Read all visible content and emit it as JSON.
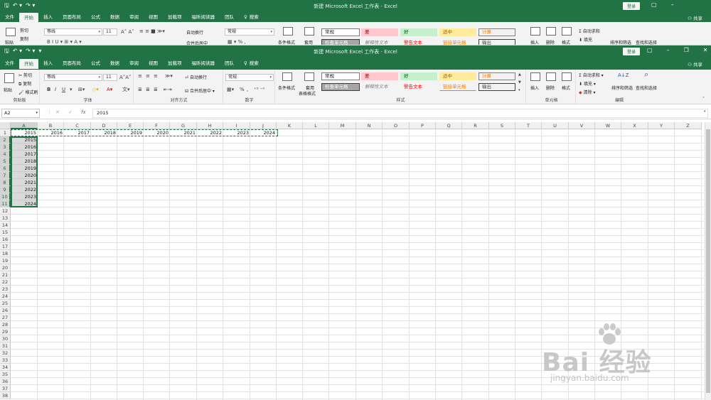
{
  "back_window": {
    "title": "新建 Microsoft Excel 工作表  -  Excel",
    "signin": "登录",
    "share": "共享",
    "tabs": [
      "文件",
      "开始",
      "插入",
      "页面布局",
      "公式",
      "数据",
      "审阅",
      "视图",
      "加载项",
      "福昕阅读器",
      "团队"
    ],
    "tellme": "搜索",
    "font_name": "等线",
    "font_size": "11",
    "number_format": "常规",
    "styles": [
      "常规",
      "差",
      "好",
      "适中",
      "计算",
      "检查单元格",
      "解释性文本",
      "警告文本",
      "链接单元格",
      "输出"
    ]
  },
  "window": {
    "title": "新建 Microsoft Excel 工作表  -  Excel",
    "signin": "登录",
    "share": "共享",
    "tabs": [
      "文件",
      "开始",
      "插入",
      "页面布局",
      "公式",
      "数据",
      "审阅",
      "视图",
      "加载项",
      "福昕阅读器",
      "团队"
    ],
    "active_tab": "开始",
    "tellme": "搜索"
  },
  "ribbon": {
    "clipboard": {
      "paste": "粘贴",
      "cut": "剪切",
      "copy": "复制",
      "format_painter": "格式刷",
      "label": "剪贴板"
    },
    "font": {
      "name": "等线",
      "size": "11",
      "bold": "B",
      "italic": "I",
      "underline": "U",
      "label": "字体"
    },
    "alignment": {
      "wrap": "自动换行",
      "merge": "合并后居中",
      "label": "对齐方式"
    },
    "number": {
      "format": "常规",
      "percent": "%",
      "comma": ",",
      "label": "数字"
    },
    "styles": {
      "conditional": "条件格式",
      "table": "套用\n表格格式",
      "table_line1": "套用",
      "table_line2": "表格格式",
      "items": [
        {
          "text": "常规",
          "bg": "#ffffff",
          "color": "#111111",
          "border": "#7a7a7a"
        },
        {
          "text": "差",
          "bg": "#ffc7ce",
          "color": "#9c0006",
          "border": "#ffc7ce"
        },
        {
          "text": "好",
          "bg": "#c6efce",
          "color": "#006100",
          "border": "#c6efce"
        },
        {
          "text": "适中",
          "bg": "#ffeb9c",
          "color": "#9c5700",
          "border": "#ffeb9c"
        },
        {
          "text": "计算",
          "bg": "#f2f2f2",
          "color": "#fa7d00",
          "border": "#7f7f7f"
        },
        {
          "text": "检查单元格",
          "bg": "#a5a5a5",
          "color": "#ffffff",
          "border": "#3f3f3f"
        },
        {
          "text": "解释性文本",
          "bg": "#f3f3f3",
          "color": "#7f7f7f",
          "border": "#f3f3f3"
        },
        {
          "text": "警告文本",
          "bg": "#f3f3f3",
          "color": "#ff0000",
          "border": "#f3f3f3"
        },
        {
          "text": "链接单元格",
          "bg": "#f3f3f3",
          "color": "#fa7d00",
          "border": "#f3f3f3"
        },
        {
          "text": "输出",
          "bg": "#f2f2f2",
          "color": "#3f3f3f",
          "border": "#3f3f3f"
        }
      ],
      "label": "样式"
    },
    "cells": {
      "insert": "插入",
      "delete": "删除",
      "format": "格式",
      "label": "单元格"
    },
    "editing": {
      "autosum": "自动求和",
      "fill": "填充",
      "clear": "清除",
      "sort": "排序和筛选",
      "find": "查找和选择",
      "label": "编辑"
    }
  },
  "formula_bar": {
    "name_box": "A2",
    "cancel": "✕",
    "enter": "✓",
    "fx": "fx",
    "value": "2015"
  },
  "grid": {
    "columns": [
      "A",
      "B",
      "C",
      "D",
      "E",
      "F",
      "G",
      "H",
      "I",
      "J",
      "K",
      "L",
      "M",
      "N",
      "O",
      "P",
      "Q",
      "R",
      "S",
      "T",
      "U",
      "V",
      "W",
      "X",
      "Y",
      "Z"
    ],
    "rows": [
      "1",
      "2",
      "3",
      "4",
      "5",
      "6",
      "7",
      "8",
      "9",
      "10",
      "11",
      "12",
      "13",
      "14",
      "15",
      "16",
      "17",
      "18",
      "19",
      "20",
      "21",
      "22",
      "23",
      "24",
      "25",
      "26",
      "27",
      "28",
      "29",
      "30",
      "31",
      "32",
      "33",
      "34",
      "35",
      "36",
      "37",
      "38"
    ],
    "row1": [
      "2015",
      "2016",
      "2017",
      "2018",
      "2019",
      "2020",
      "2021",
      "2022",
      "2023",
      "2024"
    ],
    "colA": [
      "2015",
      "2016",
      "2017",
      "2018",
      "2019",
      "2020",
      "2021",
      "2022",
      "2023",
      "2024"
    ],
    "selected_column": "A"
  },
  "watermark": {
    "text": "Bai 经验",
    "url": "jingyan.baidu.com"
  },
  "colors": {
    "accent": "#217346",
    "ribbon_bg": "#f3f3f3"
  }
}
